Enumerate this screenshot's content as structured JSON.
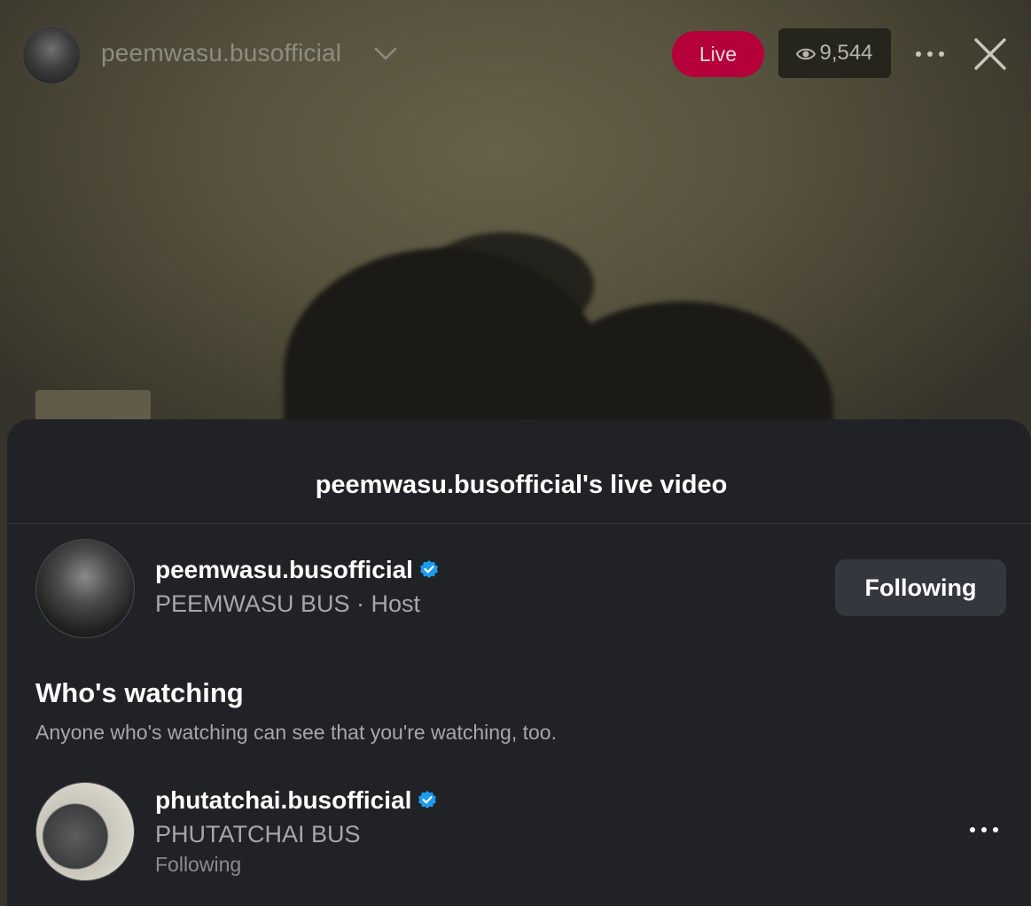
{
  "topbar": {
    "host_username": "peemwasu.busofficial",
    "live_label": "Live",
    "viewer_count": "9,544"
  },
  "sheet": {
    "title": "peemwasu.busofficial's live video",
    "host": {
      "username": "peemwasu.busofficial",
      "display_name": "PEEMWASU BUS",
      "role": "Host",
      "subtitle": "PEEMWASU BUS · Host",
      "follow_button_label": "Following"
    },
    "watching": {
      "title": "Who's watching",
      "description": "Anyone who's watching can see that you're watching, too.",
      "viewers": [
        {
          "username": "phutatchai.busofficial",
          "display_name": "PHUTATCHAI BUS",
          "status": "Following"
        }
      ]
    }
  },
  "colors": {
    "live_badge": "#b5003a",
    "sheet_background": "#212226",
    "button_background": "#35373e",
    "verified_badge": "#1d9bf0"
  },
  "icons": [
    "chevron-down-icon",
    "eye-icon",
    "more-horizontal-icon",
    "close-icon",
    "verified-badge-icon"
  ]
}
